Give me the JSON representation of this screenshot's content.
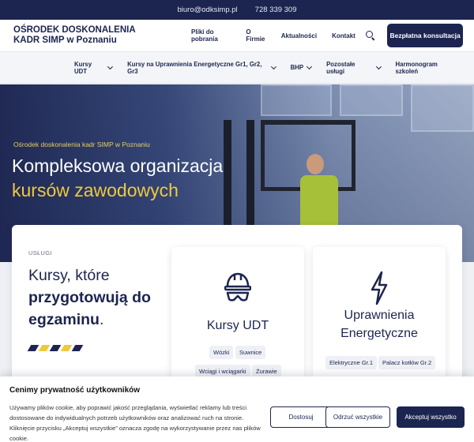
{
  "topbar": {
    "email": "biuro@odksimp.pl",
    "phone": "728 339 309"
  },
  "header": {
    "brand": "OŚRODEK DOSKONALENIA KADR SIMP w Poznaniu",
    "nav": [
      "Pliki do pobrania",
      "O Firmie",
      "Aktualności",
      "Kontakt"
    ],
    "search_icon": "search-icon",
    "cta": "Bezpłatna konsultacja"
  },
  "subnav": [
    {
      "label": "Kursy UDT",
      "dropdown": true
    },
    {
      "label": "Kursy na Uprawnienia Energetyczne Gr1, Gr2, Gr3",
      "dropdown": true
    },
    {
      "label": "BHP",
      "dropdown": true
    },
    {
      "label": "Pozostałe usługi",
      "dropdown": true
    },
    {
      "label": "Harmonogram szkoleń",
      "dropdown": false
    }
  ],
  "hero": {
    "kicker": "Ośrodek doskonalenia kadr SIMP w Poznaniu",
    "title_line1": "Kompleksowa organizacja",
    "title_line2": "kursów zawodowych"
  },
  "services": {
    "kicker": "USŁUGI",
    "lead_plain": "Kursy, które",
    "lead_bold1": "przygotowują do",
    "lead_bold2": "egzaminu",
    "lead_end": ".",
    "stripe_colors": [
      "#1c2550",
      "#f0c93a",
      "#1c2550",
      "#f0c93a",
      "#1c2550"
    ],
    "cards": [
      {
        "title": "Kursy UDT",
        "icon": "helmet-icon",
        "tags": [
          "Wózki",
          "Suwnice",
          "Wciągi i wciągarki",
          "Żurawie"
        ]
      },
      {
        "title_line1": "Uprawnienia",
        "title_line2": "Energetyczne",
        "icon": "lightning-icon",
        "tags": [
          "Elektryczne Gr.1",
          "Palacz kotłów Gr.2"
        ]
      }
    ]
  },
  "cookie": {
    "title": "Cenimy prywatność użytkowników",
    "text": "Używamy plików cookie, aby poprawić jakość przeglądania, wyświetlać reklamy lub treści dostosowane do indywidualnych potrzeb użytkowników oraz analizować ruch na stronie. Kliknięcie przycisku „Akceptuj wszystkie” oznacza zgodę na wykorzystywanie przez nas plików cookie.",
    "customize": "Dostosuj",
    "reject": "Odrzuć wszystkie",
    "accept": "Akceptuj wszystko"
  },
  "colors": {
    "navy": "#1c2550",
    "accent": "#f0c93a"
  }
}
